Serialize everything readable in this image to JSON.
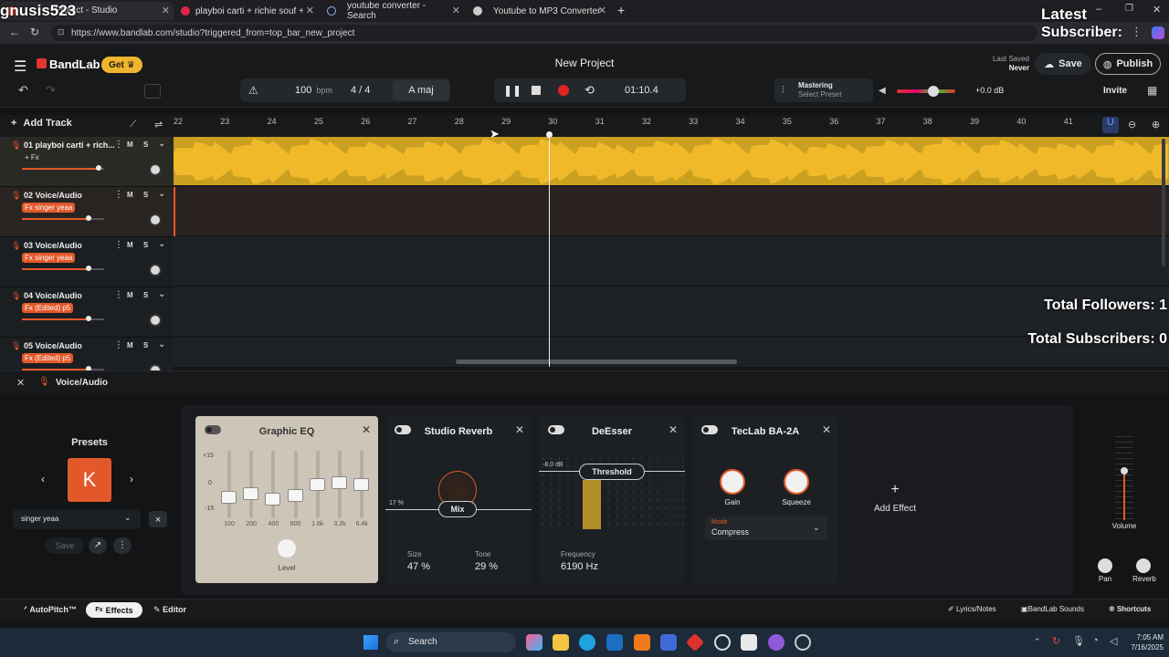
{
  "browser": {
    "tabs": [
      {
        "label": "gnusis523",
        "sub": "Project - Studio"
      },
      {
        "label": "playboi carti + richie souf + jetsc"
      },
      {
        "label": "youtube converter - Search"
      },
      {
        "label": "Youtube to MP3 Converter"
      }
    ],
    "url": "https://www.bandlab.com/studio?triggered_from=top_bar_new_project"
  },
  "overlay": {
    "latest_title": "Latest",
    "latest_sub": "Subscriber:",
    "followers": "Total Followers: 1",
    "subscribers": "Total Subscribers: 0"
  },
  "header": {
    "brand": "BandLab",
    "get_label": "Get",
    "project_title": "New Project",
    "last_saved_label": "Last Saved",
    "last_saved_value": "Never",
    "save_label": "Save",
    "publish_label": "Publish",
    "invite_label": "Invite"
  },
  "transport": {
    "tempo": "100",
    "tempo_unit": "bpm",
    "time_sig": "4 / 4",
    "key": "A maj",
    "time": "01:10.4",
    "mastering_label": "Mastering",
    "mastering_preset": "Select Preset",
    "master_db": "+0.0 dB",
    "master_level": 0.62
  },
  "timeline": {
    "add_track": "Add Track",
    "ruler": [
      "22",
      "23",
      "24",
      "25",
      "26",
      "27",
      "28",
      "29",
      "30",
      "31",
      "32",
      "33",
      "34",
      "35",
      "36",
      "37",
      "38",
      "39",
      "40",
      "41"
    ],
    "tracks": [
      {
        "name": "01 playboi carti + rich...",
        "fx": "+ Fx",
        "volume": 0.82
      },
      {
        "name": "02 Voice/Audio",
        "fx": "Fx singer yeaa",
        "volume": 0.71
      },
      {
        "name": "03 Voice/Audio",
        "fx": "Fx singer yeaa",
        "volume": 0.71
      },
      {
        "name": "04 Voice/Audio",
        "fx": "Fx (Edited) p5",
        "volume": 0.71
      },
      {
        "name": "05 Voice/Audio",
        "fx": "Fx (Edited) p5",
        "volume": 0.71
      }
    ],
    "mute": "M",
    "solo": "S"
  },
  "fxpanel": {
    "track_label": "Voice/Audio",
    "presets_label": "Presets",
    "preset_letter": "K",
    "preset_name": "singer yeaa",
    "save_label": "Save",
    "eq": {
      "title": "Graphic EQ",
      "scale": [
        "+15",
        "0",
        "-15"
      ],
      "bands": [
        "100",
        "200",
        "400",
        "800",
        "1.6k",
        "3.2k",
        "6.4k"
      ],
      "level_label": "Level"
    },
    "reverb": {
      "title": "Studio Reverb",
      "mix_label": "Mix",
      "mix_value": "17 %",
      "size_label": "Size",
      "size_value": "47 %",
      "tone_label": "Tone",
      "tone_value": "29 %"
    },
    "deesser": {
      "title": "DeEsser",
      "threshold_label": "Threshold",
      "threshold_value": "-8.0 dB",
      "freq_label": "Frequency",
      "freq_value": "6190 Hz"
    },
    "compressor": {
      "title": "TecLab BA-2A",
      "gain_label": "Gain",
      "squeeze_label": "Squeeze",
      "mode_label": "Mode",
      "mode_value": "Compress"
    },
    "add_effect": "Add Effect",
    "volume_label": "Volume",
    "pan_label": "Pan",
    "reverb_label": "Reverb"
  },
  "bottombar": {
    "autopitch": "AutoPitch™",
    "effects": "Effects",
    "editor": "Editor",
    "lyrics": "Lyrics/Notes",
    "sounds": "BandLab Sounds",
    "shortcuts": "Shortcuts"
  },
  "taskbar": {
    "search": "Search",
    "time": "7:05 AM",
    "date": "7/16/2025"
  }
}
